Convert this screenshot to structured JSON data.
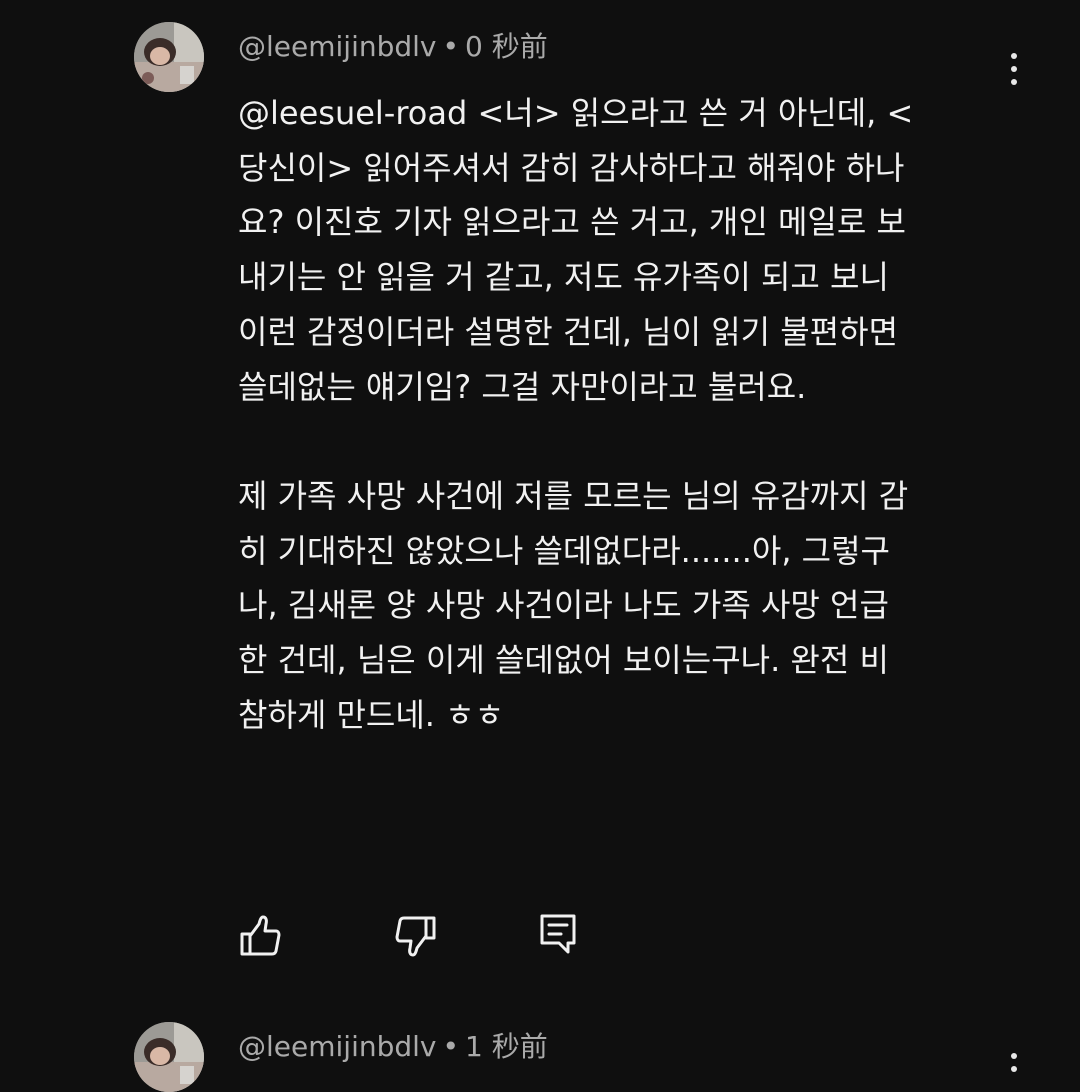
{
  "comments": [
    {
      "handle": "@leemijinbdlv",
      "separator": "•",
      "timestamp": "0 秒前",
      "paragraphs": [
        [
          "@leesuel-road  <너> 읽으라고 쓴 거 아닌데,  <",
          "당신이> 읽어주셔서 감히 감사하다고 해줘야 하나",
          "요? 이진호 기자 읽으라고 쓴 거고, 개인 메일로 보",
          "내기는 안 읽을 거 같고, 저도 유가족이 되고 보니",
          "이런 감정이더라 설명한 건데, 님이 읽기 불편하면",
          "쓸데없는 얘기임? 그걸 자만이라고 불러요."
        ],
        [
          "제 가족 사망 사건에 저를 모르는 님의 유감까지 감",
          "히 기대하진 않았으나 쓸데없다라.......아, 그렇구",
          "나, 김새론 양 사망 사건이라 나도 가족 사망 언급",
          "한 건데, 님은 이게 쓸데없어 보이는구나. 완전 비",
          "참하게 만드네. ㅎㅎ"
        ]
      ]
    },
    {
      "handle": "@leemijinbdlv",
      "separator": "•",
      "timestamp": "1 秒前"
    }
  ],
  "icons": {
    "like": "thumbs-up-icon",
    "dislike": "thumbs-down-icon",
    "reply": "reply-icon",
    "more": "more-vertical-icon"
  },
  "colors": {
    "background": "#0f0f0f",
    "text": "#f1f1f1",
    "meta_text": "#aaaaaa",
    "icon": "#f1f1f1"
  }
}
